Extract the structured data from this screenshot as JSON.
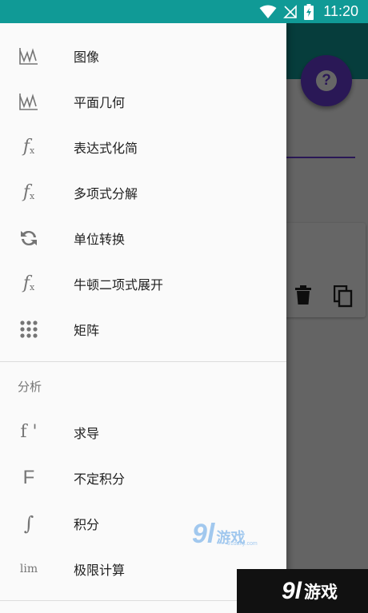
{
  "status_bar": {
    "time": "11:20"
  },
  "background": {
    "help_button": "?"
  },
  "drawer": {
    "items": [
      {
        "label": "图像",
        "icon": "graph-icon"
      },
      {
        "label": "平面几何",
        "icon": "graph-icon"
      },
      {
        "label": "表达式化简",
        "icon": "function-icon"
      },
      {
        "label": "多项式分解",
        "icon": "function-icon"
      },
      {
        "label": "单位转换",
        "icon": "swap-icon"
      },
      {
        "label": "牛顿二项式展开",
        "icon": "function-icon"
      },
      {
        "label": "矩阵",
        "icon": "grid-icon"
      }
    ],
    "section_analysis": {
      "title": "分析",
      "items": [
        {
          "label": "求导",
          "glyph": "f '"
        },
        {
          "label": "不定积分",
          "glyph": "F"
        },
        {
          "label": "积分",
          "glyph": "∫"
        },
        {
          "label": "极限计算",
          "glyph": "lim"
        }
      ]
    }
  },
  "watermark": {
    "number": "9l",
    "text": "游戏",
    "url": "91danji.com"
  },
  "colors": {
    "teal": "#109a96",
    "accent": "#6a3cd6"
  }
}
